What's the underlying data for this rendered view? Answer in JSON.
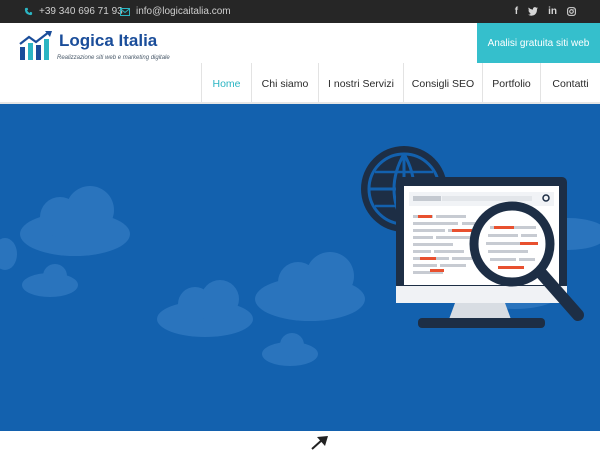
{
  "topbar": {
    "phone": "+39 340 696 71 93",
    "email": "info@logicaitalia.com",
    "social": [
      "facebook-icon",
      "twitter-icon",
      "linkedin-icon",
      "instagram-icon"
    ]
  },
  "brand": {
    "name": "Logica Italia",
    "tagline": "Realizzazione siti web e marketing digitale"
  },
  "cta": {
    "label": "Analisi gratuita siti web"
  },
  "nav": {
    "items": [
      {
        "label": "Home",
        "active": true
      },
      {
        "label": "Chi siamo",
        "active": false
      },
      {
        "label": "I nostri Servizi",
        "active": false
      },
      {
        "label": "Consigli SEO",
        "active": false
      },
      {
        "label": "Portfolio",
        "active": false
      },
      {
        "label": "Contatti",
        "active": false
      }
    ]
  },
  "hero": {
    "illustration": [
      "globe-icon",
      "monitor-illustration",
      "magnifier-icon",
      "cloud-illustration"
    ]
  },
  "colors": {
    "accent": "#35bfcc",
    "brand_blue": "#1a4d9a",
    "hero_blue": "#1361ae",
    "topbar": "#262626"
  }
}
